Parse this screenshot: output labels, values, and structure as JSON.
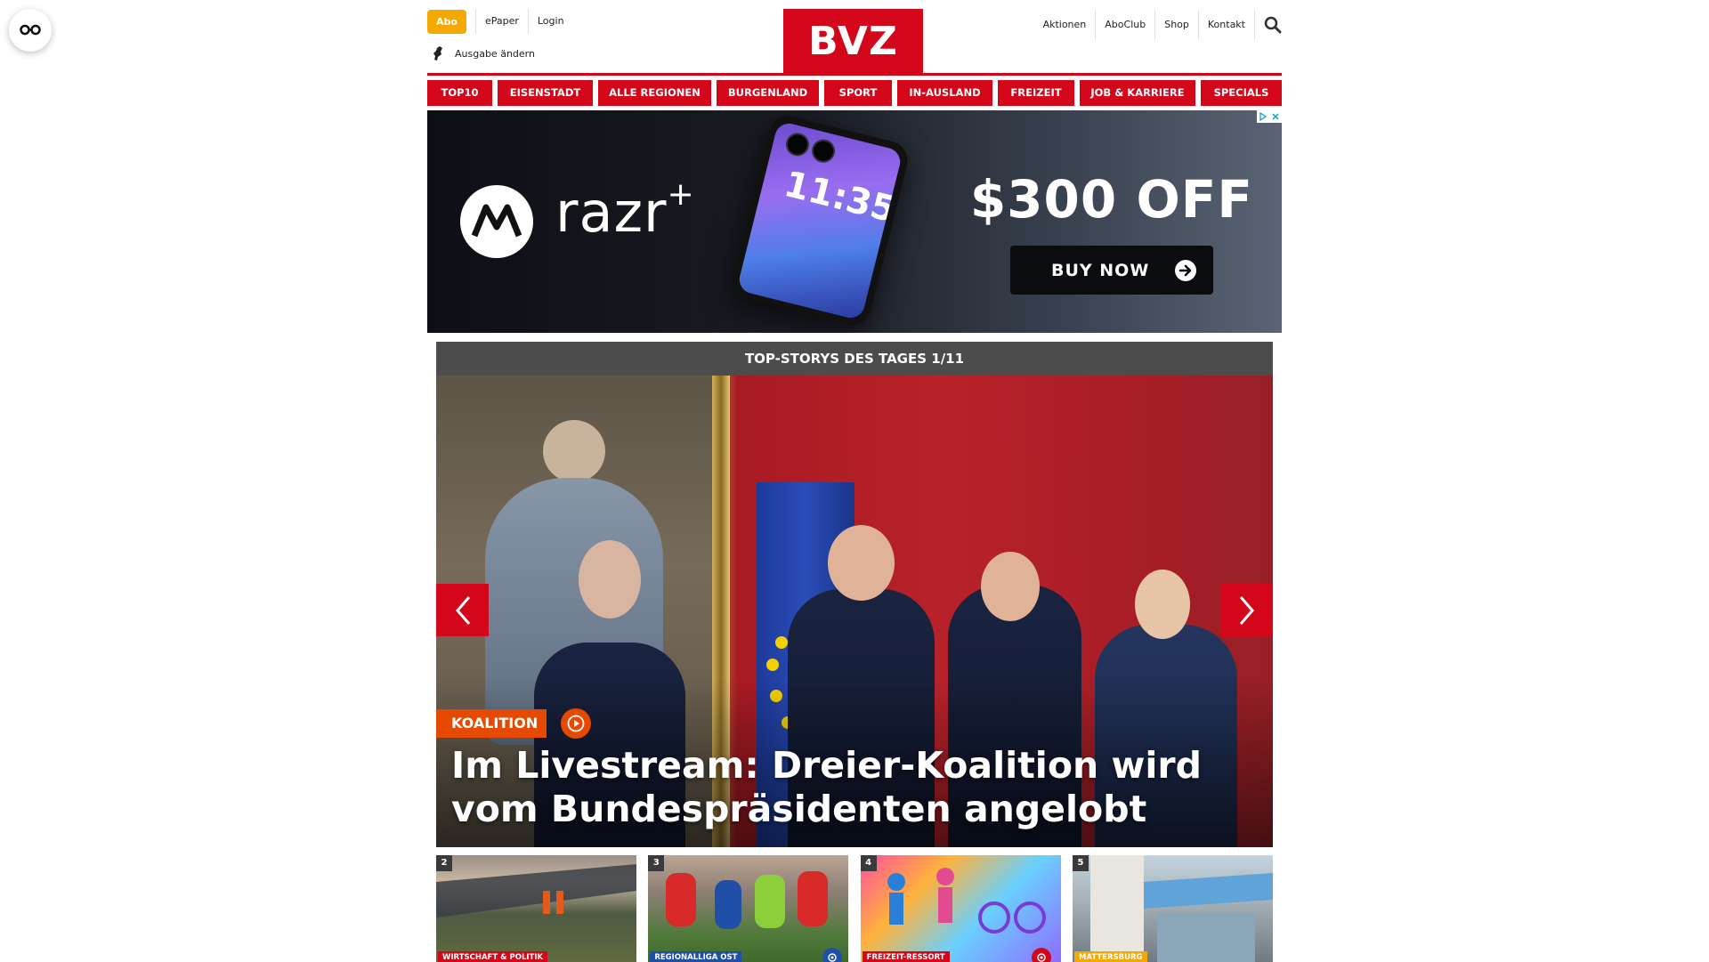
{
  "header": {
    "abo_label": "Abo",
    "top_links": [
      "ePaper",
      "Login"
    ],
    "edition_label": "Ausgabe ändern",
    "logo_text": "BVZ",
    "right_links": [
      "Aktionen",
      "AboClub",
      "Shop",
      "Kontakt"
    ]
  },
  "nav": {
    "items": [
      "TOP10",
      "EISENSTADT",
      "ALLE REGIONEN",
      "BURGENLAND",
      "SPORT",
      "IN-AUSLAND",
      "FREIZEIT",
      "JOB & KARRIERE",
      "SPECIALS"
    ]
  },
  "ad": {
    "brand": "razr",
    "brand_sup": "+",
    "phone_time": "11:35",
    "offer": "$300 OFF",
    "cta": "BUY NOW"
  },
  "stories": {
    "heading": "TOP-STORYS DES TAGES 1/11",
    "hero": {
      "tag": "KOALITION",
      "title": "Im Livestream: Dreier-Koalition wird vom Bundespräsidenten angelobt"
    },
    "teasers": [
      {
        "num": "2",
        "category": "WIRTSCHAFT & POLITIK"
      },
      {
        "num": "3",
        "category": "REGIONALLIGA OST"
      },
      {
        "num": "4",
        "category": "FREIZEIT-RESSORT"
      },
      {
        "num": "5",
        "category": "MATTERSBURG"
      }
    ]
  },
  "colors": {
    "brand_red": "#d3061a",
    "abo_orange": "#f5a800",
    "tag_orange": "#e64a00",
    "story_header": "#4c4c4c"
  }
}
